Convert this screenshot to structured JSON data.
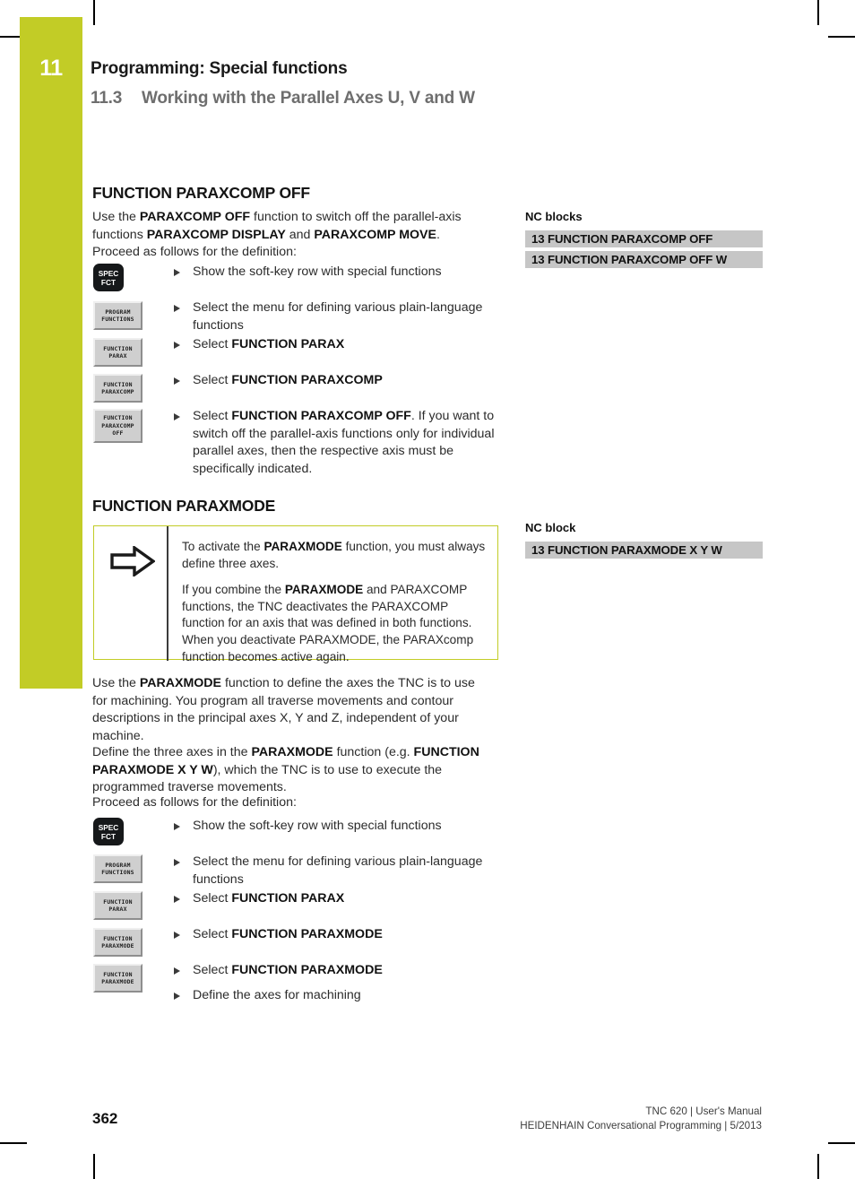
{
  "header": {
    "chapter_number": "11",
    "title": "Programming: Special functions",
    "section_number": "11.3",
    "section_title": "Working with the Parallel Axes U, V and W",
    "accent_color": "#c2cc26"
  },
  "section_paraxcomp_off": {
    "heading": "FUNCTION PARAXCOMP OFF",
    "intro_html": "Use the <b>PARAXCOMP OFF</b> function to switch off the parallel-axis functions <b>PARAXCOMP DISPLAY</b> and <b>PARAXCOMP MOVE</b>. Proceed as follows for the definition:",
    "softkeys": [
      {
        "name": "spec-fct",
        "lines": [
          "SPEC",
          "FCT"
        ],
        "style": "hardkey"
      },
      {
        "name": "program-functions",
        "lines": [
          "PROGRAM",
          "FUNCTIONS"
        ],
        "style": "softkey"
      },
      {
        "name": "function-parax",
        "lines": [
          "FUNCTION",
          "PARAX"
        ],
        "style": "softkey"
      },
      {
        "name": "function-paraxcomp",
        "lines": [
          "FUNCTION",
          "PARAXCOMP"
        ],
        "style": "softkey"
      },
      {
        "name": "function-paraxcomp-off",
        "lines": [
          "FUNCTION",
          "PARAXCOMP",
          "OFF"
        ],
        "style": "softkey"
      }
    ],
    "steps": [
      "Show the soft-key row with special functions",
      "Select the menu for defining various plain-language functions",
      "Select <b>FUNCTION PARAX</b>",
      "Select <b>FUNCTION PARAXCOMP</b>",
      "Select <b>FUNCTION PARAXCOMP OFF</b>. If you want to switch off the parallel-axis functions only for individual parallel axes, then the respective axis must be specifically indicated."
    ],
    "nc": {
      "label": "NC blocks",
      "rows": [
        "13 FUNCTION PARAXCOMP OFF",
        "13 FUNCTION PARAXCOMP OFF W"
      ]
    }
  },
  "section_paraxmode": {
    "heading": "FUNCTION PARAXMODE",
    "note": {
      "icon": "right-arrow-icon",
      "paragraph_1_html": "To activate the <b>PARAXMODE</b> function, you must always define three axes.",
      "paragraph_2_html": "If you combine the <b>PARAXMODE</b> and PARAXCOMP functions, the TNC deactivates the PARAXCOMP function for an axis that was defined in both functions. When you deactivate PARAXMODE, the PARAXcomp function becomes active again."
    },
    "body_paragraph_1_html": "Use the <b>PARAXMODE</b> function to define the axes the TNC is to use for machining. You program all traverse movements and contour descriptions in the principal axes X, Y and Z, independent of your machine.",
    "body_paragraph_2_html": "Define the three axes in the <b>PARAXMODE</b> function (e.g. <b>FUNCTION PARAXMODE X Y W</b>), which the TNC is to use to execute the programmed traverse movements.",
    "body_paragraph_3_html": "Proceed as follows for the definition:",
    "softkeys": [
      {
        "name": "spec-fct",
        "lines": [
          "SPEC",
          "FCT"
        ],
        "style": "hardkey"
      },
      {
        "name": "program-functions",
        "lines": [
          "PROGRAM",
          "FUNCTIONS"
        ],
        "style": "softkey"
      },
      {
        "name": "function-parax",
        "lines": [
          "FUNCTION",
          "PARAX"
        ],
        "style": "softkey"
      },
      {
        "name": "function-paraxmode-1",
        "lines": [
          "FUNCTION",
          "PARAXMODE"
        ],
        "style": "softkey"
      },
      {
        "name": "function-paraxmode-2",
        "lines": [
          "FUNCTION",
          "PARAXMODE"
        ],
        "style": "softkey"
      }
    ],
    "steps": [
      "Show the soft-key row with special functions",
      "Select the menu for defining various plain-language functions",
      "Select <b>FUNCTION PARAX</b>",
      "Select <b>FUNCTION PARAXMODE</b>",
      "Select <b>FUNCTION PARAXMODE</b>",
      "Define the axes for machining"
    ],
    "nc": {
      "label": "NC block",
      "rows": [
        "13 FUNCTION PARAXMODE X Y W"
      ]
    }
  },
  "footer": {
    "page_number": "362",
    "line_1": "TNC 620 | User's Manual",
    "line_2": "HEIDENHAIN Conversational Programming | 5/2013"
  }
}
